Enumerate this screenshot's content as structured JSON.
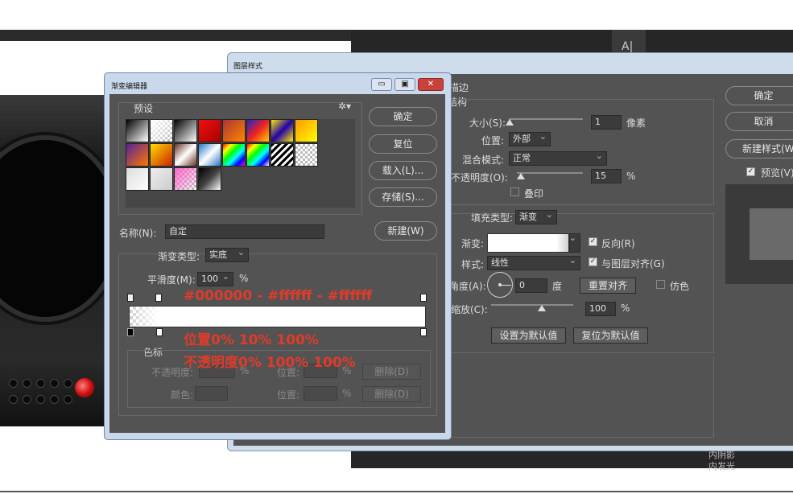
{
  "layer_style": {
    "title": "图层样式",
    "stroke_header": "描边",
    "structure_header": "结构",
    "size_label": "大小(S):",
    "size_value": "1",
    "size_unit": "像素",
    "position_label": "位置:",
    "position_value": "外部",
    "blend_label": "混合模式:",
    "blend_value": "正常",
    "opacity_label": "不透明度(O):",
    "opacity_value": "15",
    "opacity_unit": "%",
    "overprint_label": "叠印",
    "fill_type_label": "填充类型:",
    "fill_type_value": "渐变",
    "gradient_label": "渐变:",
    "reverse_label": "反向(R)",
    "style_label": "样式:",
    "style_value": "线性",
    "align_layer_label": "与图层对齐(G)",
    "angle_label": "角度(A):",
    "angle_value": "0",
    "angle_unit": "度",
    "reset_align_label": "重置对齐",
    "dither_label": "仿色",
    "scale_label": "缩放(C):",
    "scale_value": "100",
    "scale_unit": "%",
    "set_default_label": "设置为默认值",
    "reset_default_label": "复位为默认值",
    "ok_label": "确定",
    "cancel_label": "取消",
    "new_style_label": "新建样式(W",
    "preview_label": "预览(V)",
    "inner_shadow_label": "内阴影",
    "inner_glow_label": "内发光"
  },
  "gradient_editor": {
    "title": "渐变编辑器",
    "minimize_label": "▭",
    "maximize_label": "▣",
    "close_label": "✕",
    "presets_label": "预设",
    "ok_label": "确定",
    "reset_label": "复位",
    "load_label": "载入(L)...",
    "save_label": "存储(S)...",
    "name_label": "名称(N):",
    "name_value": "自定",
    "new_label": "新建(W)",
    "type_label": "渐变类型:",
    "type_value": "实底",
    "smooth_label": "平滑度(M):",
    "smooth_value": "100",
    "smooth_unit": "%",
    "color_stops_label": "色标",
    "opacity_label": "不透明度:",
    "opacity_unit": "%",
    "position_label": "位置:",
    "position_unit": "%",
    "delete_label": "删除(D)",
    "color_label": "颜色:",
    "color_position_label": "位置:",
    "color_position_unit": "%",
    "color_delete_label": "删除(D)"
  },
  "annotations": {
    "colors": "#000000 - #ffffff - #ffffff",
    "positions": "位置0% 10% 100%",
    "opacities": "不透明度0% 100% 100%"
  },
  "background": {
    "panel_letter": "A|"
  },
  "accent_colors": {
    "annotation_red": "#e03b2a",
    "dialog_bg": "#535353",
    "title_bar": "#cfdcec"
  }
}
